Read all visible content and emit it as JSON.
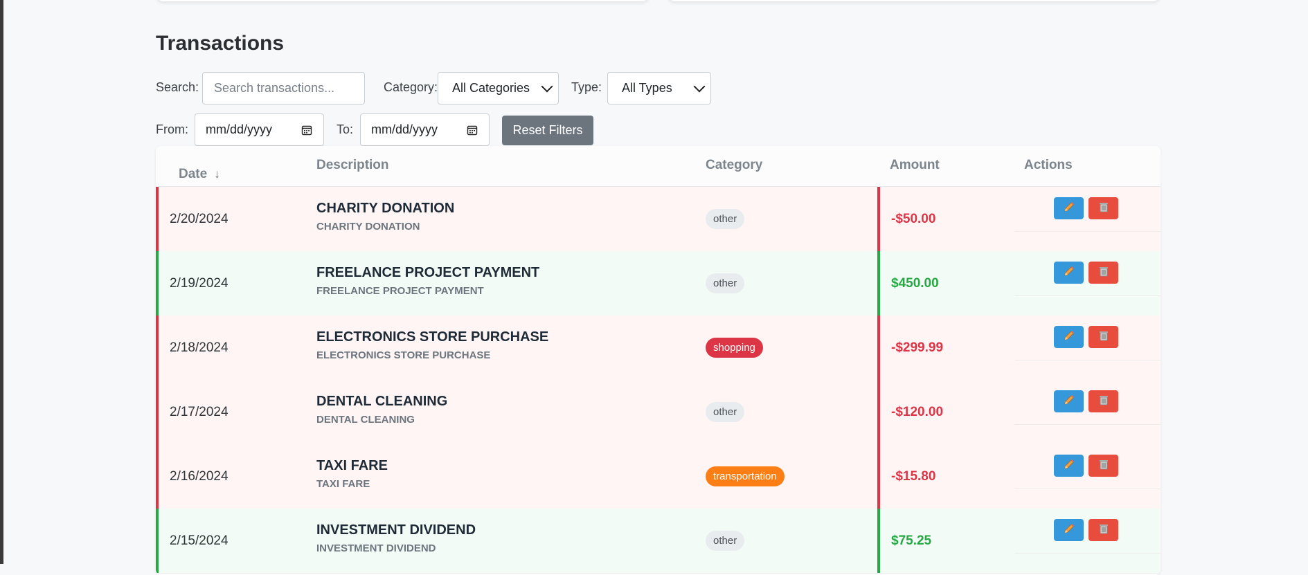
{
  "section": {
    "title": "Transactions"
  },
  "filters": {
    "search_label": "Search:",
    "search_placeholder": "Search transactions...",
    "category_label": "Category:",
    "category_value": "All Categories",
    "type_label": "Type:",
    "type_value": "All Types",
    "from_label": "From:",
    "from_value": "mm/dd/yyyy",
    "to_label": "To:",
    "to_value": "mm/dd/yyyy",
    "reset_label": "Reset Filters"
  },
  "table": {
    "headers": {
      "date": "Date",
      "sort_indicator": "↓",
      "description": "Description",
      "category": "Category",
      "amount": "Amount",
      "actions": "Actions"
    },
    "rows": [
      {
        "date": "2/20/2024",
        "description": "CHARITY DONATION",
        "sub": "CHARITY DONATION",
        "category": "other",
        "amount": "-$50.00",
        "type": "expense"
      },
      {
        "date": "2/19/2024",
        "description": "FREELANCE PROJECT PAYMENT",
        "sub": "FREELANCE PROJECT PAYMENT",
        "category": "other",
        "amount": "$450.00",
        "type": "income"
      },
      {
        "date": "2/18/2024",
        "description": "ELECTRONICS STORE PURCHASE",
        "sub": "ELECTRONICS STORE PURCHASE",
        "category": "shopping",
        "amount": "-$299.99",
        "type": "expense"
      },
      {
        "date": "2/17/2024",
        "description": "DENTAL CLEANING",
        "sub": "DENTAL CLEANING",
        "category": "other",
        "amount": "-$120.00",
        "type": "expense"
      },
      {
        "date": "2/16/2024",
        "description": "TAXI FARE",
        "sub": "TAXI FARE",
        "category": "transportation",
        "amount": "-$15.80",
        "type": "expense"
      },
      {
        "date": "2/15/2024",
        "description": "INVESTMENT DIVIDEND",
        "sub": "INVESTMENT DIVIDEND",
        "category": "other",
        "amount": "$75.25",
        "type": "income"
      }
    ]
  },
  "colors": {
    "expense": "#dc3545",
    "income": "#28a745",
    "edit": "#3498db",
    "delete": "#e74c3c",
    "shopping": "#dc3545",
    "transportation": "#fd7e14"
  },
  "icons": {
    "edit": "pencil-icon",
    "delete": "trash-icon",
    "date_picker": "calendar-icon"
  }
}
